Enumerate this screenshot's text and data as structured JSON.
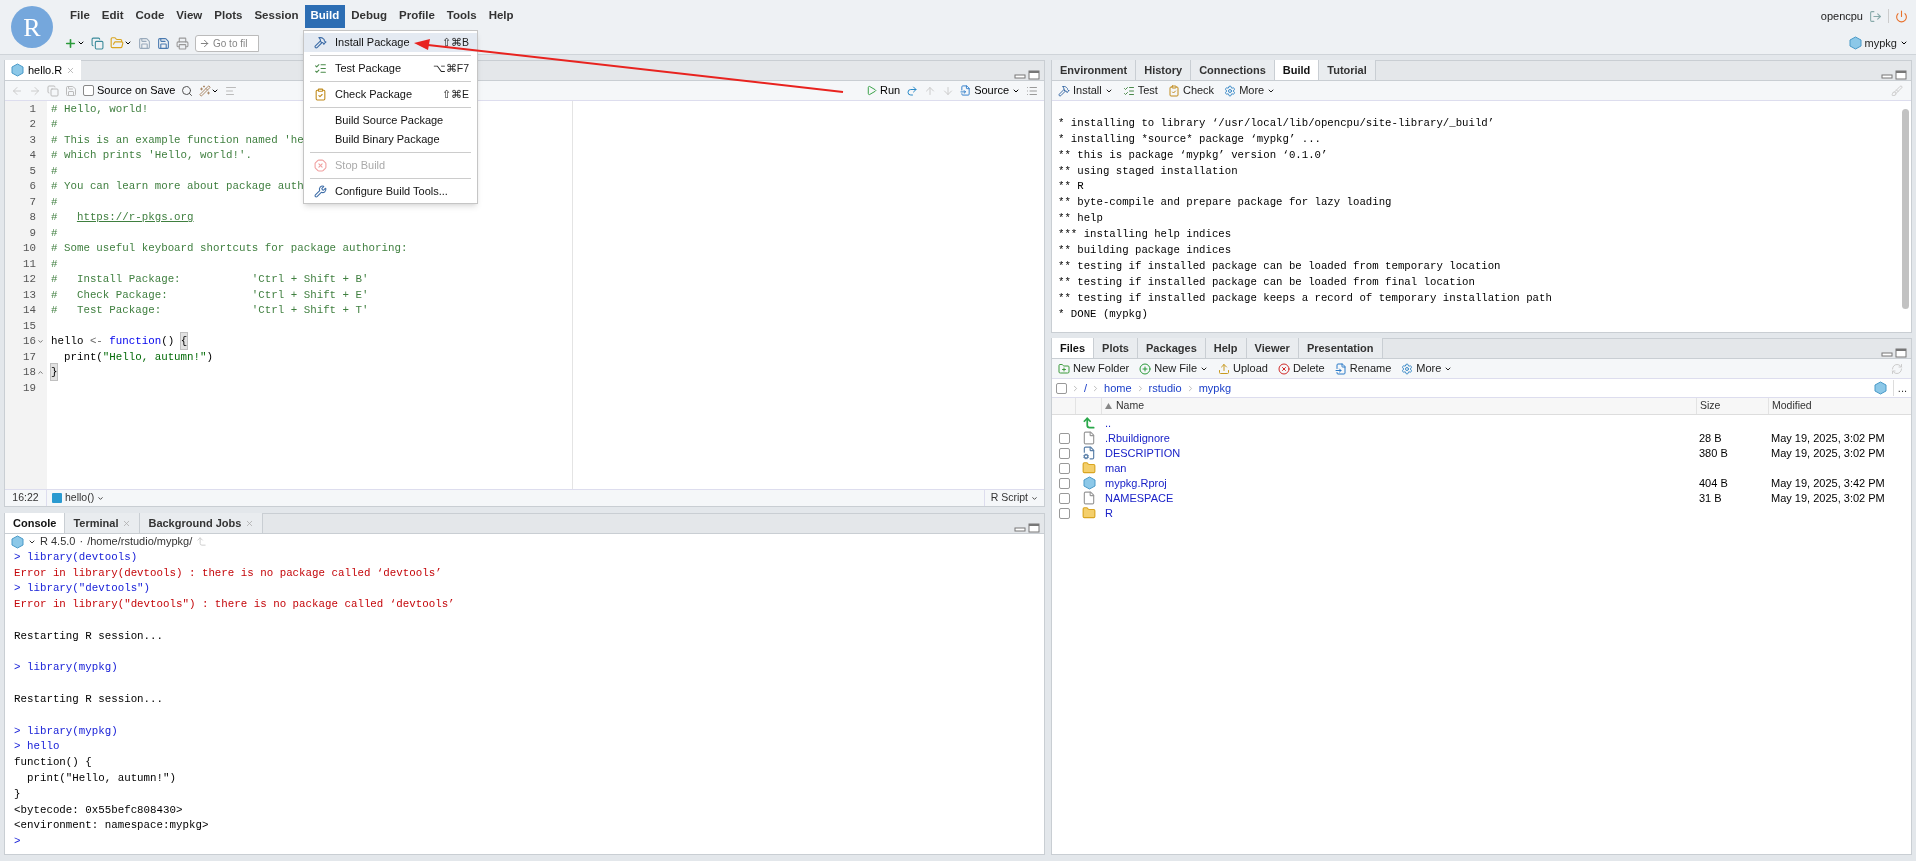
{
  "app": {
    "logo": "R",
    "menu": [
      {
        "label": "File",
        "selected": false
      },
      {
        "label": "Edit",
        "selected": false
      },
      {
        "label": "Code",
        "selected": false
      },
      {
        "label": "View",
        "selected": false
      },
      {
        "label": "Plots",
        "selected": false
      },
      {
        "label": "Session",
        "selected": false
      },
      {
        "label": "Build",
        "selected": true
      },
      {
        "label": "Debug",
        "selected": false
      },
      {
        "label": "Profile",
        "selected": false
      },
      {
        "label": "Tools",
        "selected": false
      },
      {
        "label": "Help",
        "selected": false
      }
    ],
    "user": "opencpu",
    "goto_placeholder": "Go to fil",
    "project": "mypkg"
  },
  "build_menu": [
    {
      "kind": "item",
      "label": "Install Package",
      "shortcut": "⇧⌘B",
      "selected": true,
      "disabled": false
    },
    {
      "kind": "separator"
    },
    {
      "kind": "item",
      "label": "Test Package",
      "shortcut": "⌥⌘F7",
      "selected": false,
      "disabled": false
    },
    {
      "kind": "separator"
    },
    {
      "kind": "item",
      "label": "Check Package",
      "shortcut": "⇧⌘E",
      "selected": false,
      "disabled": false
    },
    {
      "kind": "separator"
    },
    {
      "kind": "item",
      "label": "Build Source Package",
      "selected": false,
      "disabled": false
    },
    {
      "kind": "item",
      "label": "Build Binary Package",
      "selected": false,
      "disabled": false
    },
    {
      "kind": "separator"
    },
    {
      "kind": "item",
      "label": "Stop Build",
      "selected": false,
      "disabled": true
    },
    {
      "kind": "separator"
    },
    {
      "kind": "item",
      "label": "Configure Build Tools...",
      "selected": false,
      "disabled": false
    }
  ],
  "editor": {
    "tabs": [
      {
        "label": "hello.R",
        "selected": true
      }
    ],
    "source_on_save": {
      "label": "Source on Save",
      "checked": false
    },
    "run": "Run",
    "source": "Source",
    "lines": [
      {
        "number": "1",
        "segments": [
          {
            "kind": "comment",
            "text": "# Hello, world!"
          }
        ]
      },
      {
        "number": "2",
        "segments": [
          {
            "kind": "comment",
            "text": "#"
          }
        ]
      },
      {
        "number": "3",
        "segments": [
          {
            "kind": "comment",
            "text": "# This is an example function named 'he"
          }
        ]
      },
      {
        "number": "4",
        "segments": [
          {
            "kind": "comment",
            "text": "# which prints 'Hello, world!'."
          }
        ]
      },
      {
        "number": "5",
        "segments": [
          {
            "kind": "comment",
            "text": "#"
          }
        ]
      },
      {
        "number": "6",
        "segments": [
          {
            "kind": "comment",
            "text": "# You can learn more about package auth"
          }
        ]
      },
      {
        "number": "7",
        "segments": [
          {
            "kind": "comment",
            "text": "#"
          }
        ]
      },
      {
        "number": "8",
        "segments": [
          {
            "kind": "comment",
            "text": "#   "
          },
          {
            "kind": "link",
            "text": "https://r-pkgs.org"
          }
        ]
      },
      {
        "number": "9",
        "segments": [
          {
            "kind": "comment",
            "text": "#"
          }
        ]
      },
      {
        "number": "10",
        "segments": [
          {
            "kind": "comment",
            "text": "# Some useful keyboard shortcuts for package authoring:"
          }
        ]
      },
      {
        "number": "11",
        "segments": [
          {
            "kind": "comment",
            "text": "#"
          }
        ]
      },
      {
        "number": "12",
        "segments": [
          {
            "kind": "comment",
            "text": "#   Install Package:           'Ctrl + Shift + B'"
          }
        ]
      },
      {
        "number": "13",
        "segments": [
          {
            "kind": "comment",
            "text": "#   Check Package:             'Ctrl + Shift + E'"
          }
        ]
      },
      {
        "number": "14",
        "segments": [
          {
            "kind": "comment",
            "text": "#   Test Package:              'Ctrl + Shift + T'"
          }
        ]
      },
      {
        "number": "15"
      },
      {
        "number": "16",
        "fold_start": true,
        "segments": [
          {
            "kind": "plain",
            "text": "hello "
          },
          {
            "kind": "operator",
            "text": "<- "
          },
          {
            "kind": "keyword",
            "text": "function"
          },
          {
            "kind": "plain",
            "text": "() "
          },
          {
            "kind": "bracket",
            "text": "{"
          }
        ]
      },
      {
        "number": "17",
        "segments": [
          {
            "kind": "plain",
            "text": "  print("
          },
          {
            "kind": "string",
            "text": "\"Hello, autumn!\""
          },
          {
            "kind": "plain",
            "text": ")"
          }
        ]
      },
      {
        "number": "18",
        "fold_end": true,
        "segments": [
          {
            "kind": "bracket",
            "text": "}"
          }
        ]
      },
      {
        "number": "19"
      }
    ],
    "status": {
      "position": "16:22",
      "scope": "hello()",
      "file_type": "R Script"
    }
  },
  "console": {
    "tabs": [
      {
        "label": "Console",
        "selected": true,
        "closable": false
      },
      {
        "label": "Terminal",
        "selected": false,
        "closable": true
      },
      {
        "label": "Background Jobs",
        "selected": false,
        "closable": true
      }
    ],
    "version": "R 4.5.0",
    "separator": "·",
    "path": "/home/rstudio/mypkg/",
    "lines": [
      {
        "kind": "input",
        "text": "> library(devtools)"
      },
      {
        "kind": "error",
        "text": "Error in library(devtools) : there is no package called ‘devtools’"
      },
      {
        "kind": "input",
        "text": "> library(\"devtools\")"
      },
      {
        "kind": "error",
        "text": "Error in library(\"devtools\") : there is no package called ‘devtools’"
      },
      {
        "kind": "blank"
      },
      {
        "kind": "output",
        "text": "Restarting R session..."
      },
      {
        "kind": "blank"
      },
      {
        "kind": "input",
        "text": "> library(mypkg)"
      },
      {
        "kind": "blank"
      },
      {
        "kind": "output",
        "text": "Restarting R session..."
      },
      {
        "kind": "blank"
      },
      {
        "kind": "input",
        "text": "> library(mypkg)"
      },
      {
        "kind": "input",
        "text": "> hello"
      },
      {
        "kind": "output",
        "text": "function() {"
      },
      {
        "kind": "output",
        "text": "  print(\"Hello, autumn!\")"
      },
      {
        "kind": "output",
        "text": "}"
      },
      {
        "kind": "output",
        "text": "<bytecode: 0x55befc808430>"
      },
      {
        "kind": "output",
        "text": "<environment: namespace:mypkg>"
      },
      {
        "kind": "input",
        "text": ">"
      }
    ]
  },
  "build_pane": {
    "tabs": [
      {
        "label": "Environment",
        "selected": false
      },
      {
        "label": "History",
        "selected": false
      },
      {
        "label": "Connections",
        "selected": false
      },
      {
        "label": "Build",
        "selected": true
      },
      {
        "label": "Tutorial",
        "selected": false
      }
    ],
    "toolbar": [
      {
        "label": "Install",
        "dropdown": true
      },
      {
        "label": "Test",
        "dropdown": false
      },
      {
        "label": "Check",
        "dropdown": false
      },
      {
        "label": "More",
        "dropdown": true
      }
    ],
    "output": [
      "* installing to library ‘/usr/local/lib/opencpu/site-library/_build’",
      "* installing *source* package ‘mypkg’ ...",
      "** this is package ‘mypkg’ version ‘0.1.0’",
      "** using staged installation",
      "** R",
      "** byte-compile and prepare package for lazy loading",
      "** help",
      "*** installing help indices",
      "** building package indices",
      "** testing if installed package can be loaded from temporary location",
      "** testing if installed package can be loaded from final location",
      "** testing if installed package keeps a record of temporary installation path",
      "* DONE (mypkg)"
    ]
  },
  "files_pane": {
    "tabs": [
      {
        "label": "Files",
        "selected": true
      },
      {
        "label": "Plots",
        "selected": false
      },
      {
        "label": "Packages",
        "selected": false
      },
      {
        "label": "Help",
        "selected": false
      },
      {
        "label": "Viewer",
        "selected": false
      },
      {
        "label": "Presentation",
        "selected": false
      }
    ],
    "toolbar": [
      {
        "label": "New Folder",
        "dropdown": false
      },
      {
        "label": "New File",
        "dropdown": true
      },
      {
        "label": "Upload",
        "dropdown": false
      },
      {
        "label": "Delete",
        "dropdown": false
      },
      {
        "label": "Rename",
        "dropdown": false
      },
      {
        "label": "More",
        "dropdown": true
      }
    ],
    "select_all_checked": false,
    "breadcrumb": [
      "/",
      "home",
      "rstudio",
      "mypkg"
    ],
    "more": "...",
    "columns": [
      "Name",
      "Size",
      "Modified"
    ],
    "rows": [
      {
        "kind": "parent",
        "name": ".."
      },
      {
        "kind": "file",
        "name": ".Rbuildignore",
        "size": "28 B",
        "modified": "May 19, 2025, 3:02 PM",
        "checked": false
      },
      {
        "kind": "settings",
        "name": "DESCRIPTION",
        "size": "380 B",
        "modified": "May 19, 2025, 3:02 PM",
        "checked": false
      },
      {
        "kind": "folder",
        "name": "man",
        "checked": false
      },
      {
        "kind": "project",
        "name": "mypkg.Rproj",
        "size": "404 B",
        "modified": "May 19, 2025, 3:42 PM",
        "checked": false
      },
      {
        "kind": "file",
        "name": "NAMESPACE",
        "size": "31 B",
        "modified": "May 19, 2025, 3:02 PM",
        "checked": false
      },
      {
        "kind": "folder",
        "name": "R",
        "checked": false
      }
    ]
  }
}
